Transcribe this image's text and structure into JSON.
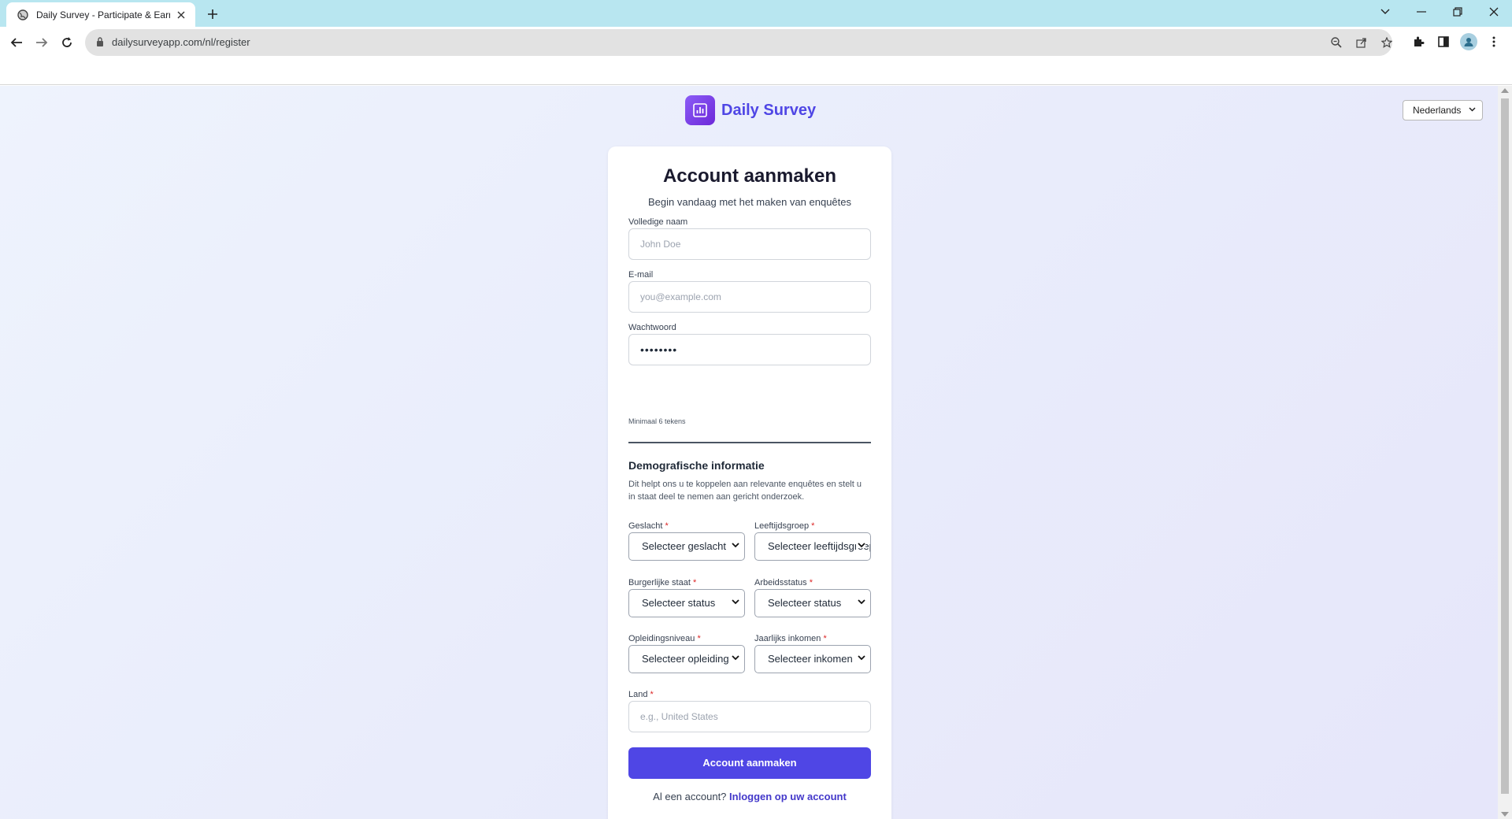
{
  "browser": {
    "tab_title": "Daily Survey - Participate & Earn",
    "url": "dailysurveyapp.com/nl/register"
  },
  "header": {
    "brand_name": "Daily Survey",
    "language_selected": "Nederlands"
  },
  "form": {
    "title": "Account aanmaken",
    "subtitle": "Begin vandaag met het maken van enquêtes",
    "fullname_label": "Volledige naam",
    "fullname_placeholder": "John Doe",
    "email_label": "E-mail",
    "email_placeholder": "you@example.com",
    "password_label": "Wachtwoord",
    "password_value": "••••••••",
    "password_hint": "Minimaal 6 tekens",
    "demographics_title": "Demografische informatie",
    "demographics_desc": "Dit helpt ons u te koppelen aan relevante enquêtes en stelt u in staat deel te nemen aan gericht onderzoek.",
    "required_mark": "*",
    "gender_label": "Geslacht",
    "gender_value": "Selecteer geslacht",
    "age_label": "Leeftijdsgroep",
    "age_value": "Selecteer leeftijdsgroep",
    "marital_label": "Burgerlijke staat",
    "marital_value": "Selecteer status",
    "employment_label": "Arbeidsstatus",
    "employment_value": "Selecteer status",
    "education_label": "Opleidingsniveau",
    "education_value": "Selecteer opleiding",
    "income_label": "Jaarlijks inkomen",
    "income_value": "Selecteer inkomen",
    "country_label": "Land",
    "country_placeholder": "e.g., United States",
    "submit_label": "Account aanmaken",
    "login_prompt": "Al een account?",
    "login_link": "Inloggen op uw account"
  },
  "colors": {
    "accent": "#4f46e5",
    "logo_bg": "#7c3aed",
    "tabbar": "#b8e6f0",
    "required": "#dc2626"
  }
}
